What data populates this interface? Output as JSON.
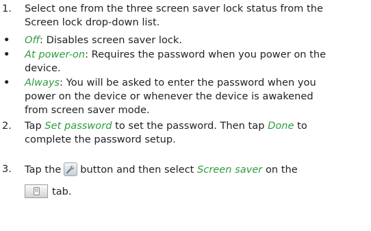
{
  "steps": [
    {
      "number": "1.",
      "text_1": "Select one from the three screen saver lock status from the",
      "text_2": "Screen lock drop-down list."
    },
    {
      "number": "2.",
      "pre": "Tap ",
      "link_1": "Set password",
      "mid": " to set the password. Then tap ",
      "link_2": "Done",
      "post": " to",
      "line_2": "complete the password setup."
    },
    {
      "number": "3.",
      "pre": "Tap the",
      "icon": "wrench-settings-icon",
      "mid": "button and then select ",
      "link": "Screen saver",
      "post": " on the",
      "tab_icon": "phone-tab-icon",
      "line_2": "tab."
    }
  ],
  "bullets": [
    {
      "marker": "•",
      "term": "Off",
      "desc_1": ": Disables screen saver lock."
    },
    {
      "marker": "•",
      "term": "At power-on",
      "desc_1": ": Requires the password when you power on the",
      "desc_2": "device."
    },
    {
      "marker": "•",
      "term": "Always",
      "desc_1": ": You will be asked to enter the password when you",
      "desc_2": "power on the device or whenever the device is awakened",
      "desc_3": "from screen saver mode."
    }
  ],
  "colors": {
    "text": "#222222",
    "emphasis": "#2e9c3e"
  }
}
